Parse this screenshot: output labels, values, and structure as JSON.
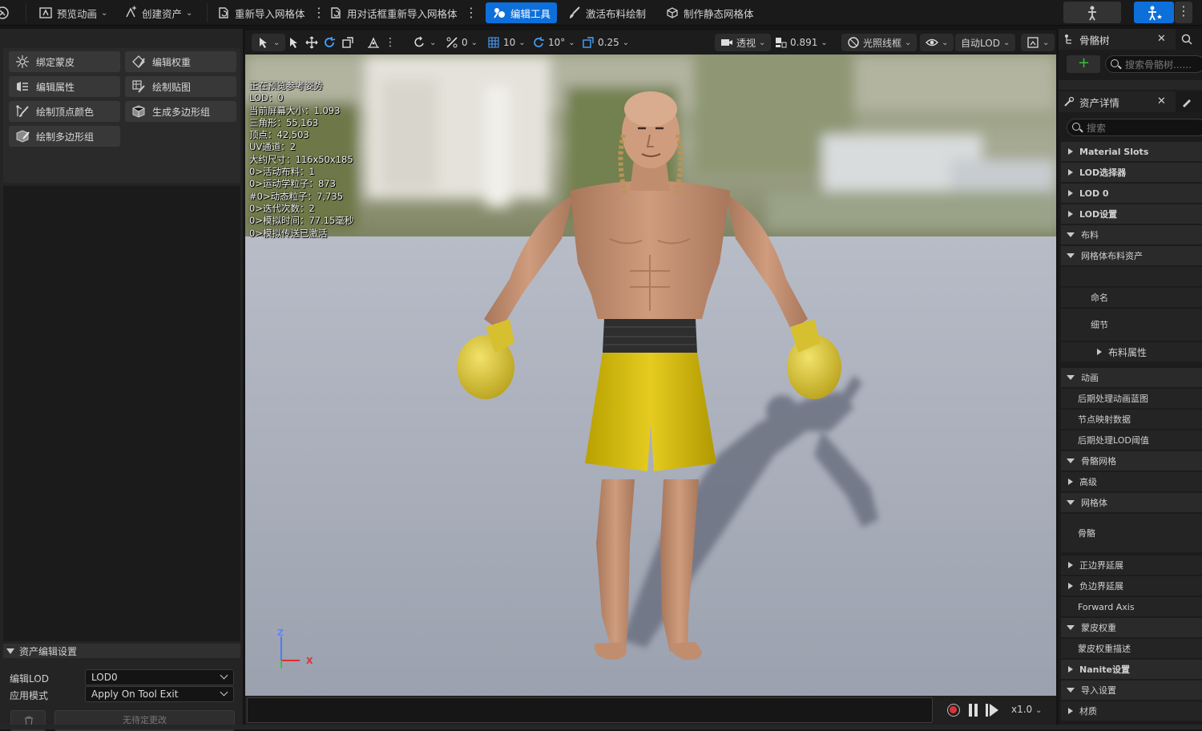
{
  "toolbar": {
    "preview_anim": "预览动画",
    "create_asset": "创建资产",
    "reimport_mesh": "重新导入网格体",
    "reimport_dialog": "用对话框重新导入网格体",
    "edit_tools": "编辑工具",
    "activate_cloth": "激活布料绘制",
    "make_static": "制作静态网格体"
  },
  "left_tools": [
    {
      "label": "绑定蒙皮",
      "icon": "bind-skin-icon"
    },
    {
      "label": "编辑权重",
      "icon": "edit-weights-icon"
    },
    {
      "label": "编辑属性",
      "icon": "edit-attributes-icon"
    },
    {
      "label": "绘制贴图",
      "icon": "paint-maps-icon"
    },
    {
      "label": "绘制顶点颜色",
      "icon": "paint-vertex-color-icon"
    },
    {
      "label": "生成多边形组",
      "icon": "generate-polygroups-icon"
    },
    {
      "label": "绘制多边形组",
      "icon": "paint-polygroups-icon"
    }
  ],
  "asset_settings": {
    "header": "资产编辑设置",
    "edit_lod_label": "编辑LOD",
    "edit_lod_value": "LOD0",
    "apply_mode_label": "应用模式",
    "apply_mode_value": "Apply On Tool Exit",
    "discard_button": "无待定更改"
  },
  "viewport": {
    "toolbar": {
      "rot_snap": "0",
      "grid_snap": "10",
      "angle_snap": "10°",
      "scale_snap": "0.25",
      "view_mode": "透视",
      "screen_pct": "0.891",
      "lighting": "光照线框",
      "lod": "自动LOD"
    },
    "stats": [
      "正在预览参考姿势",
      "LOD：0",
      "当前屏幕大小：1.093",
      "三角形：55,163",
      "顶点：42,503",
      "UV通道：2",
      "大约尺寸：116x50x185",
      "0>活动布料：1",
      "0>运动学粒子：873",
      "#0>动态粒子：7,735",
      "0>迭代次数：2",
      "0>模拟时间：77.15毫秒",
      "0>模拟传送已激活"
    ],
    "axis_z": "Z",
    "axis_x": "X",
    "speed": "x1.0"
  },
  "right": {
    "skeleton_tree_tab": "骨骼树",
    "skeleton_search_placeholder": "搜索骨骼树......",
    "asset_details_tab": "资产详情",
    "details_search_placeholder": "搜索",
    "rows": [
      {
        "label": "Material Slots",
        "state": "collapsed",
        "bold": true
      },
      {
        "label": "LOD选择器",
        "state": "collapsed",
        "bold": true
      },
      {
        "label": "LOD 0",
        "state": "collapsed",
        "bold": true
      },
      {
        "label": "LOD设置",
        "state": "collapsed",
        "bold": true
      },
      {
        "label": "布料",
        "state": "expanded",
        "bold": false
      },
      {
        "label": "网格体布料资产",
        "state": "expanded",
        "bold": false
      },
      {
        "label": "命名",
        "state": "none",
        "bold": false
      },
      {
        "label": "细节",
        "state": "none",
        "bold": false
      },
      {
        "label": "布料属性",
        "state": "collapsed",
        "bold": false
      },
      {
        "label": "动画",
        "state": "expanded",
        "bold": false
      },
      {
        "label": "后期处理动画蓝图",
        "state": "none",
        "bold": false
      },
      {
        "label": "节点映射数据",
        "state": "none",
        "bold": false
      },
      {
        "label": "后期处理LOD阈值",
        "state": "none",
        "bold": false
      },
      {
        "label": "骨骼网格",
        "state": "expanded",
        "bold": false
      },
      {
        "label": "高级",
        "state": "collapsed",
        "bold": false
      },
      {
        "label": "网格体",
        "state": "expanded",
        "bold": false
      },
      {
        "label": "骨骼",
        "state": "none",
        "bold": false
      },
      {
        "label": "正边界延展",
        "state": "collapsed",
        "bold": false
      },
      {
        "label": "负边界延展",
        "state": "collapsed",
        "bold": false
      },
      {
        "label": "Forward Axis",
        "state": "none",
        "bold": false
      },
      {
        "label": "蒙皮权重",
        "state": "expanded",
        "bold": false
      },
      {
        "label": "蒙皮权重描述",
        "state": "none",
        "bold": false
      },
      {
        "label": "Nanite设置",
        "state": "collapsed",
        "bold": true
      },
      {
        "label": "导入设置",
        "state": "expanded",
        "bold": false
      },
      {
        "label": "材质",
        "state": "collapsed",
        "bold": false
      }
    ]
  },
  "colors": {
    "accent": "#0d6fd9",
    "record": "#e0303a"
  }
}
